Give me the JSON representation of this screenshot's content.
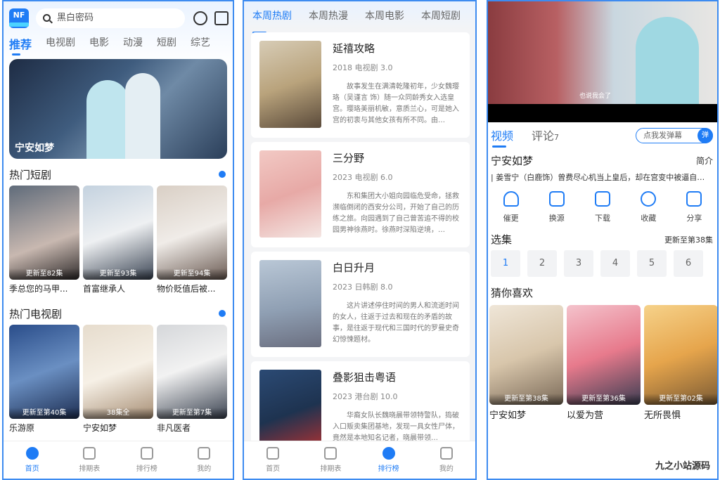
{
  "p1": {
    "search_placeholder": "黑白密码",
    "tabs": [
      "推荐",
      "电视剧",
      "电影",
      "动漫",
      "短剧",
      "综艺"
    ],
    "hero_title": "宁安如梦",
    "section1": "热门短剧",
    "shorts": [
      {
        "badge": "更新至82集",
        "title": "季总您的马甲..."
      },
      {
        "badge": "更新至93集",
        "title": "首富继承人"
      },
      {
        "badge": "更新至94集",
        "title": "物价贬值后被..."
      }
    ],
    "section2": "热门电视剧",
    "tv": [
      {
        "badge": "更新至第40集",
        "title": "乐游原"
      },
      {
        "badge": "38集全",
        "title": "宁安如梦"
      },
      {
        "badge": "更新至第7集",
        "title": "非凡医者"
      }
    ],
    "nav": [
      "首页",
      "排期表",
      "排行榜",
      "我的"
    ]
  },
  "p2": {
    "tabs": [
      "本周热剧",
      "本周热漫",
      "本周电影",
      "本周短剧"
    ],
    "items": [
      {
        "title": "延禧攻略",
        "meta": "2018 电视剧 3.0",
        "desc": "故事发生在满清乾隆初年，少女魏璎珞（吴谨言 饰）随一众同龄秀女入选皇宫。璎珞美丽机敏，意质兰心，可是她入宫的初衷与其他女孩有所不同。由…",
        "color": "#b9a37c"
      },
      {
        "title": "三分野",
        "meta": "2023 电视剧 6.0",
        "desc": "东和集团大小姐向园临危受命，拯救濒临倒闭的西安分公司，开始了自己的历练之旅。向园遇到了自己曾苦追不得的校园男神徐燕时。徐燕时深陷逆境，…",
        "color": "#e7a9a6"
      },
      {
        "title": "白日升月",
        "meta": "2023 日韩剧 8.0",
        "desc": "这片讲述停住时间的男人和流逝时间的女人，往返于过去和现在的矛盾的故事，是往返于现代和三国时代的罗曼史奇幻惊悚题材。",
        "color": "#8f9fb3"
      },
      {
        "title": "叠影狙击粤语",
        "meta": "2023 港台剧 10.0",
        "desc": "华裔女队长魏晓晨带领特警队，捣破入口贩卖集团基地，发现一具女性尸体，竟然是本地知名记者，晓晨带领…",
        "color": "#1e3350"
      }
    ],
    "nav": [
      "首页",
      "排期表",
      "排行榜",
      "我的"
    ]
  },
  "p3": {
    "video_caption": "也说我会了",
    "tab_video": "视频",
    "tab_comment": "评论",
    "comment_count": "7",
    "danmu_placeholder": "点我发弹幕",
    "danmu_btn": "弹",
    "title": "宁安如梦",
    "intro": "简介",
    "desc": "| 姜雪宁（白鹿饰）曾费尽心机当上皇后，却在宫变中被逼自…",
    "actions": [
      "催更",
      "换源",
      "下载",
      "收藏",
      "分享"
    ],
    "episodes_label": "选集",
    "episodes_more": "更新至第38集",
    "episodes": [
      "1",
      "2",
      "3",
      "4",
      "5",
      "6"
    ],
    "like_label": "猜你喜欢",
    "likes": [
      {
        "badge": "更新至第38集",
        "title": "宁安如梦"
      },
      {
        "badge": "更新至第36集",
        "title": "以爱为营"
      },
      {
        "badge": "更新至第02集",
        "title": "无所畏惧"
      }
    ],
    "watermark": "九之小站源码"
  }
}
